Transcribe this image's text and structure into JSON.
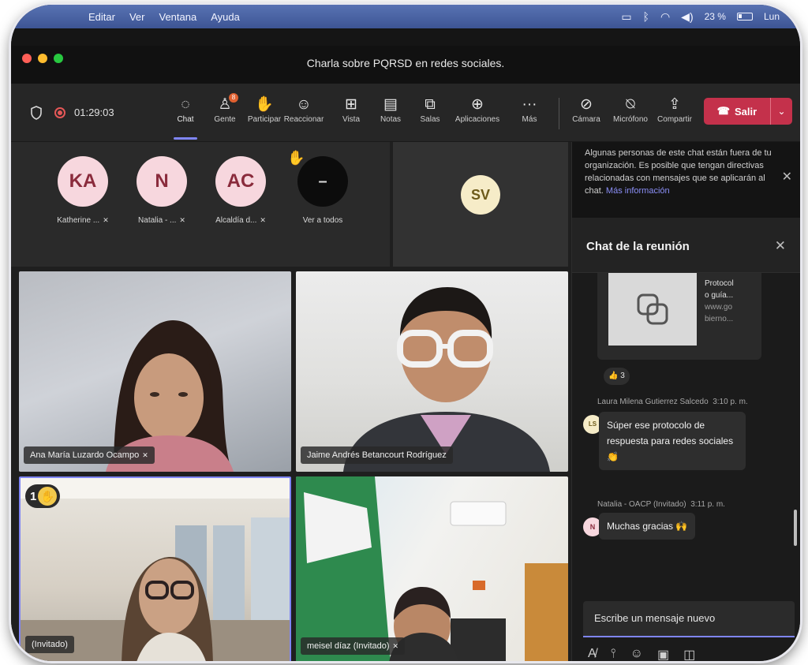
{
  "menubar": {
    "items": [
      "Editar",
      "Ver",
      "Ventana",
      "Ayuda"
    ],
    "battery": "23 %",
    "clock": "Lun"
  },
  "window": {
    "title": "Charla sobre PQRSD en redes sociales."
  },
  "toolbar": {
    "timer": "01:29:03",
    "tools": [
      {
        "label": "Chat",
        "icon": "chat-icon"
      },
      {
        "label": "Gente",
        "icon": "people-icon",
        "badge": "8"
      },
      {
        "label": "Participar",
        "icon": "raise-hand-icon"
      },
      {
        "label": "Reaccionar",
        "icon": "smiley-icon"
      },
      {
        "label": "Vista",
        "icon": "grid-view-icon"
      },
      {
        "label": "Notas",
        "icon": "notes-icon"
      },
      {
        "label": "Salas",
        "icon": "rooms-icon"
      },
      {
        "label": "Aplicaciones",
        "icon": "add-app-icon"
      },
      {
        "label": "Más",
        "icon": "more-icon"
      },
      {
        "label": "Cámara",
        "icon": "camera-off-icon"
      },
      {
        "label": "Micrófono",
        "icon": "mic-off-icon"
      },
      {
        "label": "Compartir",
        "icon": "share-icon"
      }
    ],
    "leave_label": "Salir"
  },
  "participants": [
    {
      "initials": "KA",
      "name": "Katherine ..."
    },
    {
      "initials": "N",
      "name": "Natalia - ..."
    },
    {
      "initials": "AC",
      "name": "Alcaldía d..."
    },
    {
      "initials": "–",
      "name": "Ver a todos"
    }
  ],
  "spotlight": {
    "initials": "SV"
  },
  "videos": [
    {
      "name": "Ana María Luzardo Ocampo"
    },
    {
      "name": "Jaime Andrés Betancourt Rodríguez"
    },
    {
      "name": "(Invitado)",
      "raised_hand_order": "1"
    },
    {
      "name": "meisel díaz (Invitado)"
    }
  ],
  "panel": {
    "notice_text": "Algunas personas de este chat están fuera de tu organización. Es posible que tengan directivas relacionadas con mensajes que se aplicarán al chat.",
    "notice_link": "Más información",
    "chat_title": "Chat de la reunión",
    "card_title_1": "Protocol",
    "card_title_2": "o guía...",
    "card_url_1": "www.go",
    "card_url_2": "bierno...",
    "card_reaction_count": "3",
    "messages": [
      {
        "author": "Laura Milena Gutierrez Salcedo",
        "time": "3:10 p. m.",
        "initials": "LS",
        "text": "Súper ese protocolo de respuesta para redes sociales"
      },
      {
        "author": "Natalia - OACP (Invitado)",
        "time": "3:11 p. m.",
        "initials": "N",
        "text": "Muchas gracias"
      }
    ],
    "composer_placeholder": "Escribe un mensaje nuevo"
  },
  "colors": {
    "accent": "#7f85f5",
    "leave": "#c4314b",
    "menubar": "#4763a8"
  }
}
